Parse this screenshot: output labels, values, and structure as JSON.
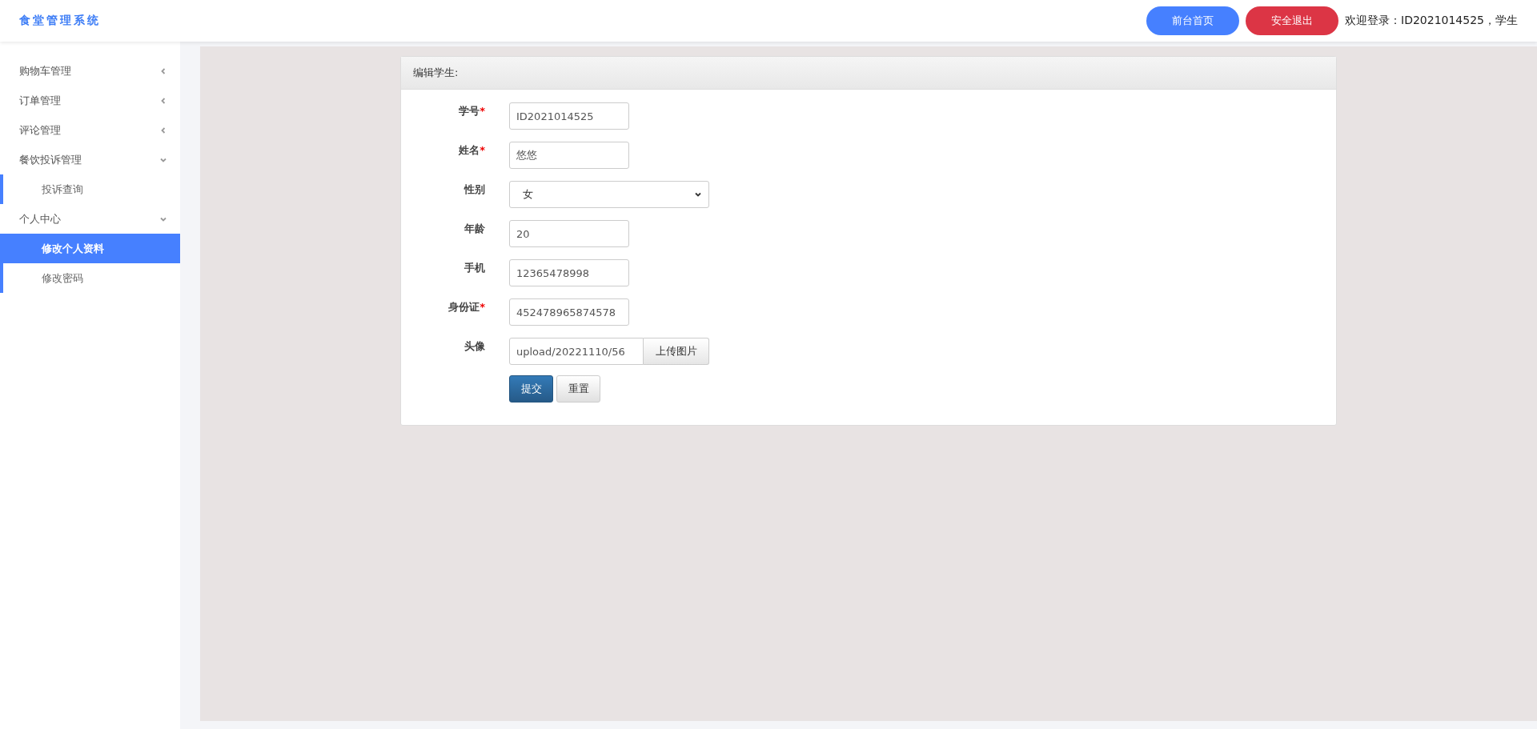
{
  "header": {
    "title": "食堂管理系统",
    "buttons": [
      {
        "label": "前台首页",
        "kind": "primary"
      },
      {
        "label": "安全退出",
        "kind": "danger"
      }
    ],
    "welcome": "欢迎登录：ID2021014525，学生"
  },
  "sidebar": {
    "items": [
      {
        "label": "购物车管理",
        "expanded": false
      },
      {
        "label": "订单管理",
        "expanded": false
      },
      {
        "label": "评论管理",
        "expanded": false
      },
      {
        "label": "餐饮投诉管理",
        "expanded": true,
        "children": [
          {
            "label": "投诉查询",
            "selected": false
          }
        ]
      },
      {
        "label": "个人中心",
        "expanded": true,
        "children": [
          {
            "label": "修改个人资料",
            "selected": true
          },
          {
            "label": "修改密码",
            "selected": false
          }
        ]
      }
    ]
  },
  "form": {
    "title": "编辑学生:",
    "required_mark": "*",
    "fields": [
      {
        "kind": "text",
        "label": "学号",
        "required": true,
        "value": "ID2021014525"
      },
      {
        "kind": "text",
        "label": "姓名",
        "required": true,
        "value": "悠悠"
      },
      {
        "kind": "select",
        "label": "性别",
        "required": false,
        "value": "女"
      },
      {
        "kind": "text",
        "label": "年龄",
        "required": false,
        "value": "20"
      },
      {
        "kind": "text",
        "label": "手机",
        "required": false,
        "value": "12365478998"
      },
      {
        "kind": "text",
        "label": "身份证",
        "required": true,
        "value": "452478965874578"
      },
      {
        "kind": "file",
        "label": "头像",
        "required": false,
        "value": "upload/20221110/56",
        "button": "上传图片"
      }
    ],
    "submit": "提交",
    "reset": "重置"
  }
}
